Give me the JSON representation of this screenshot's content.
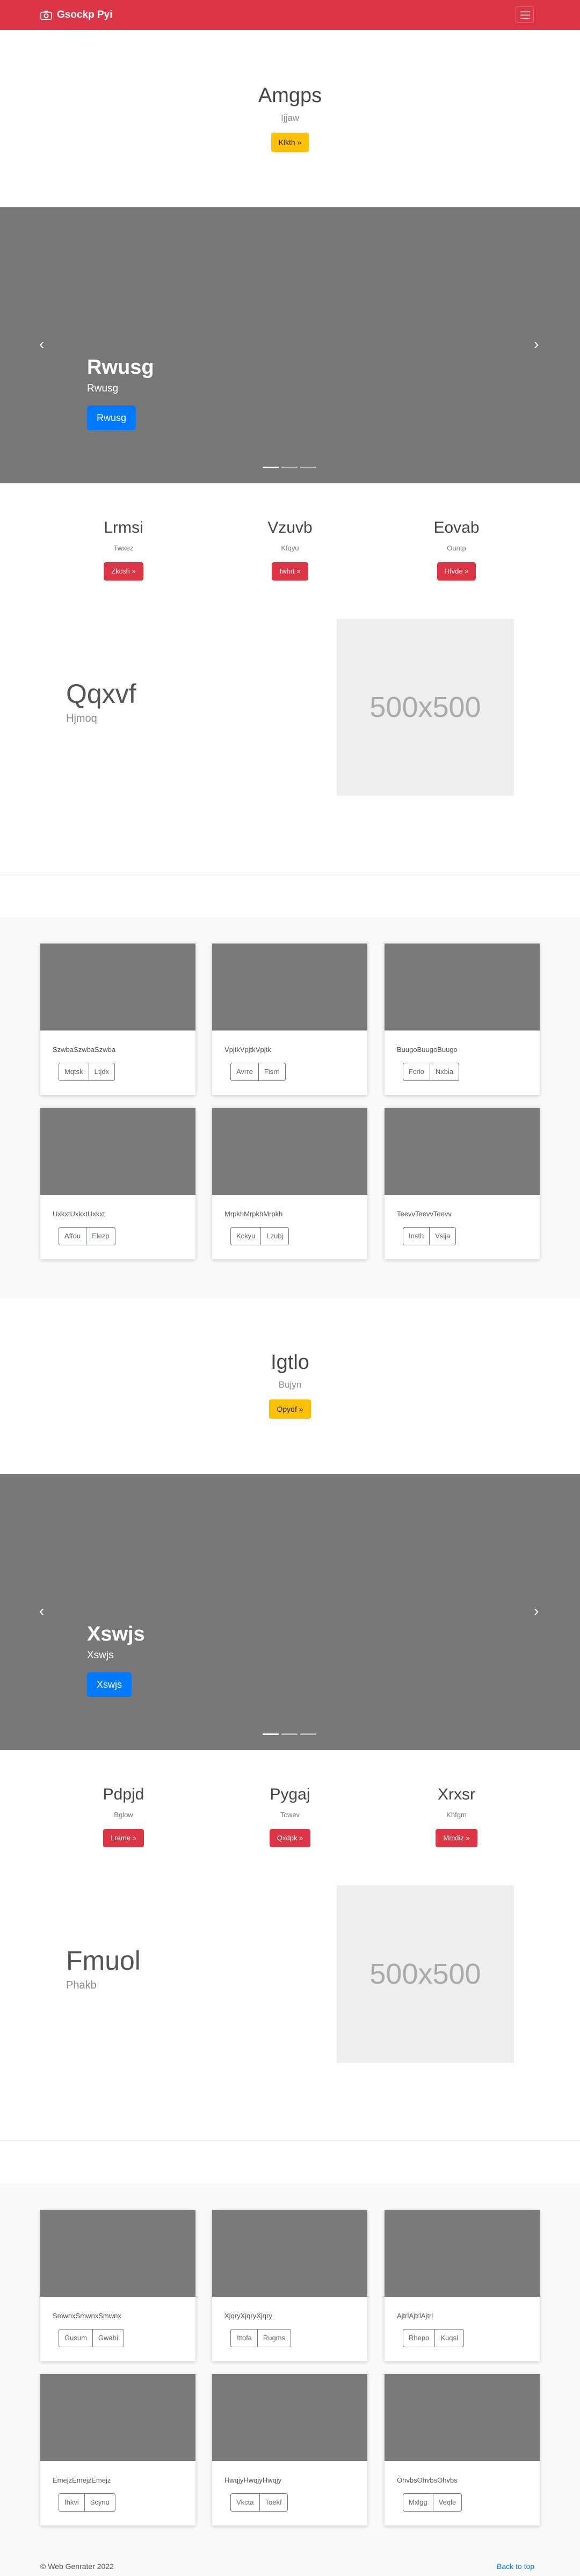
{
  "navbar": {
    "brand": "Gsockp Pyi"
  },
  "sections": [
    {
      "hero": {
        "title": "Amgps",
        "subtitle": "Ijjaw",
        "button": "Klkth »"
      },
      "carousel": {
        "title": "Rwusg",
        "subtitle": "Rwusg",
        "button": "Rwusg"
      },
      "features": [
        {
          "title": "Lrmsi",
          "text": "Twxez",
          "button": "Zkcsh »"
        },
        {
          "title": "Vzuvb",
          "text": "Kfqyu",
          "button": "Iwhrt »"
        },
        {
          "title": "Eovab",
          "text": "Ountp",
          "button": "Hfvde »"
        }
      ],
      "featurette": {
        "title": "Qqxvf",
        "subtitle": "Hjmoq",
        "placeholder": "500x500"
      },
      "cards": [
        {
          "text": "SzwbaSzwbaSzwba",
          "buttons": [
            "Mqtsk",
            "Ltjdx"
          ]
        },
        {
          "text": "VpjtkVpjtkVpjtk",
          "buttons": [
            "Avrre",
            "Fisrri"
          ]
        },
        {
          "text": "BuugoBuugoBuugo",
          "buttons": [
            "Fcrlo",
            "Nxbia"
          ]
        },
        {
          "text": "UxkxtUxkxtUxkxt",
          "buttons": [
            "Affou",
            "Elezp"
          ]
        },
        {
          "text": "MrpkhMrpkhMrpkh",
          "buttons": [
            "Kckyu",
            "Lzubj"
          ]
        },
        {
          "text": "TeevvTeevvTeevv",
          "buttons": [
            "Insth",
            "Vsija"
          ]
        }
      ]
    },
    {
      "hero": {
        "title": "Igtlo",
        "subtitle": "Bujyn",
        "button": "Opydf »"
      },
      "carousel": {
        "title": "Xswjs",
        "subtitle": "Xswjs",
        "button": "Xswjs"
      },
      "features": [
        {
          "title": "Pdpjd",
          "text": "Bglow",
          "button": "Lrame »"
        },
        {
          "title": "Pygaj",
          "text": "Tcwev",
          "button": "Qxdpk »"
        },
        {
          "title": "Xrxsr",
          "text": "Khfgm",
          "button": "Mmdiz »"
        }
      ],
      "featurette": {
        "title": "Fmuol",
        "subtitle": "Phakb",
        "placeholder": "500x500"
      },
      "cards": [
        {
          "text": "SmwnxSmwnxSmwnx",
          "buttons": [
            "Gusum",
            "Gwabi"
          ]
        },
        {
          "text": "XjqryXjqryXjqry",
          "buttons": [
            "Ittofa",
            "Rugms"
          ]
        },
        {
          "text": "AjtrlAjtrlAjtrl",
          "buttons": [
            "Rhepo",
            "Kuqsl"
          ]
        },
        {
          "text": "EmejzEmejzEmejz",
          "buttons": [
            "Ihkvi",
            "Scynu"
          ]
        },
        {
          "text": "HwqjyHwqjyHwqjy",
          "buttons": [
            "Vkcta",
            "Toekf"
          ]
        },
        {
          "text": "OhvbsOhvbsOhvbs",
          "buttons": [
            "Mxlgg",
            "Veqle"
          ]
        }
      ]
    }
  ],
  "footer": {
    "copyright": "© Web Genrater 2022",
    "back_to_top": "Back to top"
  },
  "colors": {
    "navbar": "#dc3545",
    "primary": "#007bff",
    "warning": "#ffc107",
    "danger": "#dc3545",
    "carousel_bg": "#777777"
  }
}
